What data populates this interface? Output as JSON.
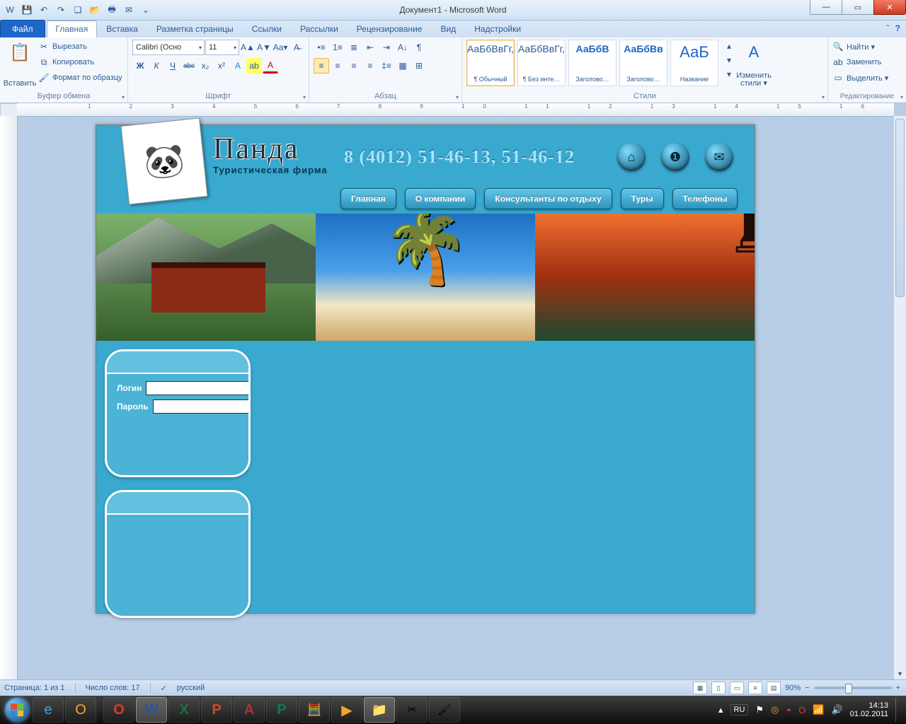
{
  "window": {
    "title": "Документ1 - Microsoft Word"
  },
  "qat": {
    "save": "💾",
    "undo": "↶",
    "redo": "↷",
    "new": "❏",
    "open": "📂",
    "quick": "⌄",
    "mail": "✉",
    "print": "🖶"
  },
  "tabs": {
    "file": "Файл",
    "items": [
      "Главная",
      "Вставка",
      "Разметка страницы",
      "Ссылки",
      "Рассылки",
      "Рецензирование",
      "Вид",
      "Надстройки"
    ],
    "selected": 0
  },
  "ribbon": {
    "clipboard": {
      "label": "Буфер обмена",
      "paste": "Вставить",
      "cut": "Вырезать",
      "copy": "Копировать",
      "format": "Формат по образцу"
    },
    "font": {
      "label": "Шрифт",
      "name": "Calibri (Осно",
      "size": "11",
      "btns": {
        "bold": "Ж",
        "italic": "К",
        "under": "Ч",
        "strike": "abc",
        "sub": "x₂",
        "sup": "x²",
        "clear": "Aa",
        "case": "Aa▾",
        "grow": "A▲",
        "shrink": "A▼",
        "effects": "A",
        "hl": "ab",
        "color": "A"
      }
    },
    "para": {
      "label": "Абзац"
    },
    "styles": {
      "label": "Стили",
      "change": "Изменить стили ▾",
      "items": [
        {
          "prev": "АаБбВвГг,",
          "name": "¶ Обычный",
          "sel": true,
          "cls": ""
        },
        {
          "prev": "АаБбВвГг,",
          "name": "¶ Без инте…",
          "sel": false,
          "cls": ""
        },
        {
          "prev": "АаБбВ",
          "name": "Заголово…",
          "sel": false,
          "cls": "c1"
        },
        {
          "prev": "АаБбВв",
          "name": "Заголово…",
          "sel": false,
          "cls": "c1"
        },
        {
          "prev": "АаБ",
          "name": "Название",
          "sel": false,
          "cls": "c2"
        }
      ]
    },
    "editing": {
      "label": "Редактирование",
      "find": "Найти ▾",
      "replace": "Заменить",
      "select": "Выделить ▾"
    }
  },
  "site": {
    "brand": "Панда",
    "sub": "Туристическая  фирма",
    "phone": "8 (4012) 51-46-13, 51-46-12",
    "nav": [
      "Главная",
      "О компании",
      "Консультанты по отдыху",
      "Туры",
      "Телефоны"
    ],
    "login": {
      "loginLbl": "Логин",
      "passLbl": "Пароль"
    }
  },
  "status": {
    "page": "Страница: 1 из 1",
    "words": "Число слов: 17",
    "lang": "русский",
    "zoom": "90%"
  },
  "tray": {
    "lang": "RU",
    "time": "14:13",
    "date": "01.02.2011"
  }
}
